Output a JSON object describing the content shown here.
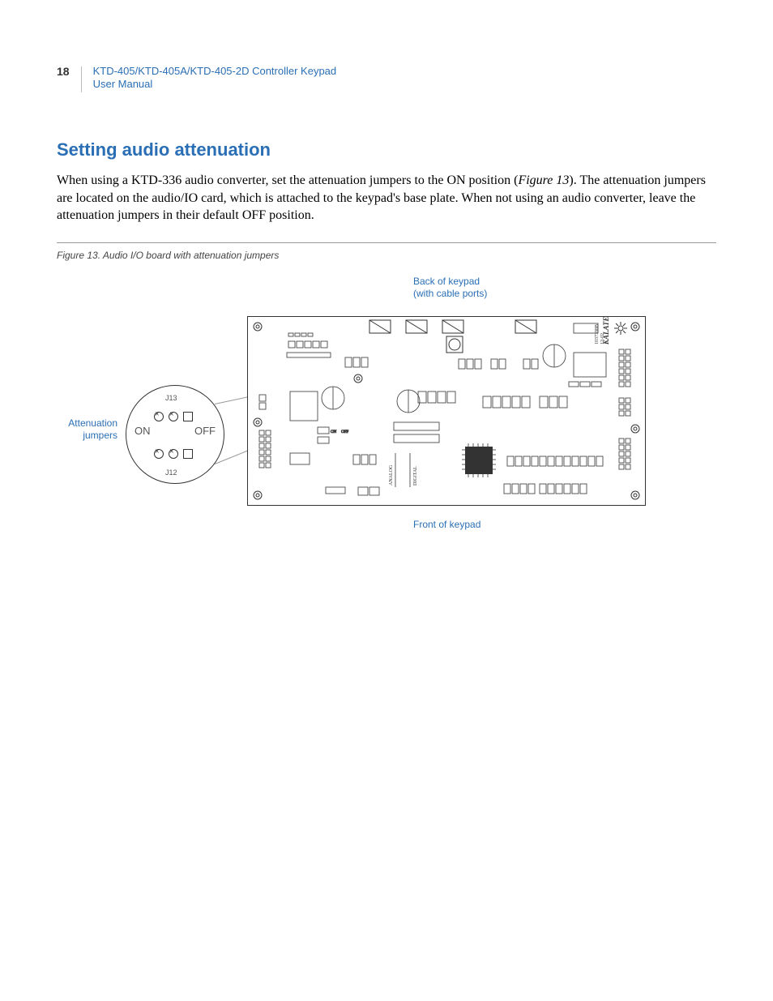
{
  "page_number": "18",
  "header": {
    "line1": "KTD-405/KTD-405A/KTD-405-2D Controller Keypad",
    "line2": "User Manual"
  },
  "section_title": "Setting audio attenuation",
  "body_text": "When using a KTD-336 audio converter, set the attenuation jumpers to the ON position (",
  "fig_ref": "Figure 13",
  "body_text_after": ").  The attenuation jumpers are located on the audio/IO card, which is attached to the keypad's base plate. When not using an audio converter, leave the attenuation jumpers in their default OFF position.",
  "figure": {
    "caption": "Figure 13. Audio I/O board with attenuation jumpers",
    "labels": {
      "back_l1": "Back of keypad",
      "back_l2": "(with cable ports)",
      "front": "Front of keypad",
      "atten_l1": "Attenuation",
      "atten_l2": "jumpers",
      "j13": "J13",
      "j12": "J12",
      "on": "ON",
      "off": "OFF",
      "brand": "KALATEL",
      "rev": "12-02",
      "part": "1037398B",
      "analog": "ANALOG",
      "digital": "DIGITAL"
    }
  }
}
